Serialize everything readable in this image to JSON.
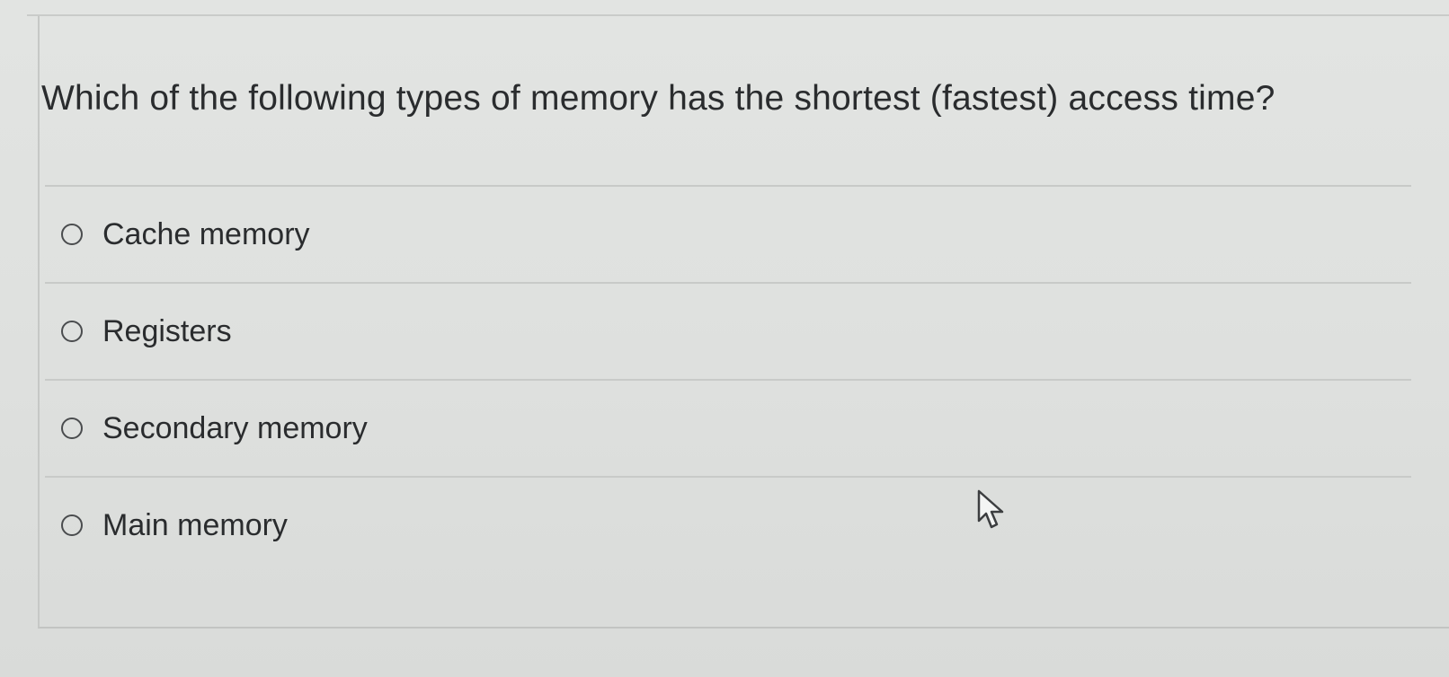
{
  "question": {
    "text": "Which of the following types of memory has the shortest (fastest) access time?"
  },
  "answers": [
    {
      "label": "Cache memory",
      "selected": false
    },
    {
      "label": "Registers",
      "selected": false
    },
    {
      "label": "Secondary memory",
      "selected": false
    },
    {
      "label": "Main memory",
      "selected": false
    }
  ],
  "icons": {
    "radio": "radio-unchecked-icon",
    "cursor": "mouse-pointer-icon"
  },
  "colors": {
    "background": "#dcdedc",
    "text": "#2a2c2e",
    "divider": "#c8cac8",
    "radio_border": "#4a4c4e"
  }
}
